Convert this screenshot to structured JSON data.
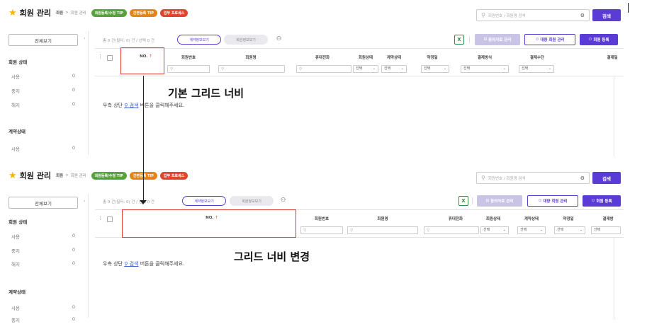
{
  "header": {
    "title": "회원 관리",
    "breadcrumb": [
      "회원",
      ">",
      "회원 관리"
    ],
    "tips": [
      {
        "label": "회원등록/수정 TIP",
        "color": "#58a23c"
      },
      {
        "label": "간편등록 TIP",
        "color": "#e58417"
      },
      {
        "label": "업무 프로세스",
        "color": "#e0452d"
      }
    ],
    "search_placeholder": "회원번호 / 회원명 검색",
    "search_button": "검색"
  },
  "sidebar": {
    "all_button": "전체보기",
    "groups": [
      {
        "title": "회원 상태",
        "items": [
          {
            "label": "사용",
            "count": "0"
          },
          {
            "label": "중지",
            "count": "0"
          },
          {
            "label": "해지",
            "count": "0"
          }
        ]
      },
      {
        "title": "계약상태",
        "items": [
          {
            "label": "사용",
            "count": "0"
          },
          {
            "label": "중지",
            "count": "0"
          }
        ]
      }
    ]
  },
  "toolbar": {
    "info_total": "총 0 건(필터: 0) 건 / 선택 0 건",
    "tab_active": "계약정보보기",
    "tab_inactive": "회원정보보기",
    "btn_bulk_data": "동의자료 관리",
    "btn_bulk_member": "대량 회원 관리",
    "btn_register": "회원 등록"
  },
  "grid": {
    "col_no": "NO.",
    "sort_arrow": "↑",
    "col_member_no": "회원번호",
    "col_member_name": "회원명",
    "col_phone": "휴대전화",
    "col_member_status": "회원상태",
    "col_contract_status": "계약상태",
    "col_contract_date": "약정일",
    "col_pay_method": "결제방식",
    "col_pay_means": "결제수단",
    "col_pay_date": "결제일",
    "col_pay_date_cut": "결제방",
    "select_placeholder": "선택"
  },
  "empty_message": {
    "prefix": "우측 상단",
    "link": "검색",
    "suffix": "버튼을 클릭해주세요."
  },
  "annotations": {
    "top": "기본 그리드 너비",
    "bottom": "그리드 너비 변경"
  },
  "colors": {
    "accent": "#5b3bd6",
    "highlight": "#e53935"
  }
}
